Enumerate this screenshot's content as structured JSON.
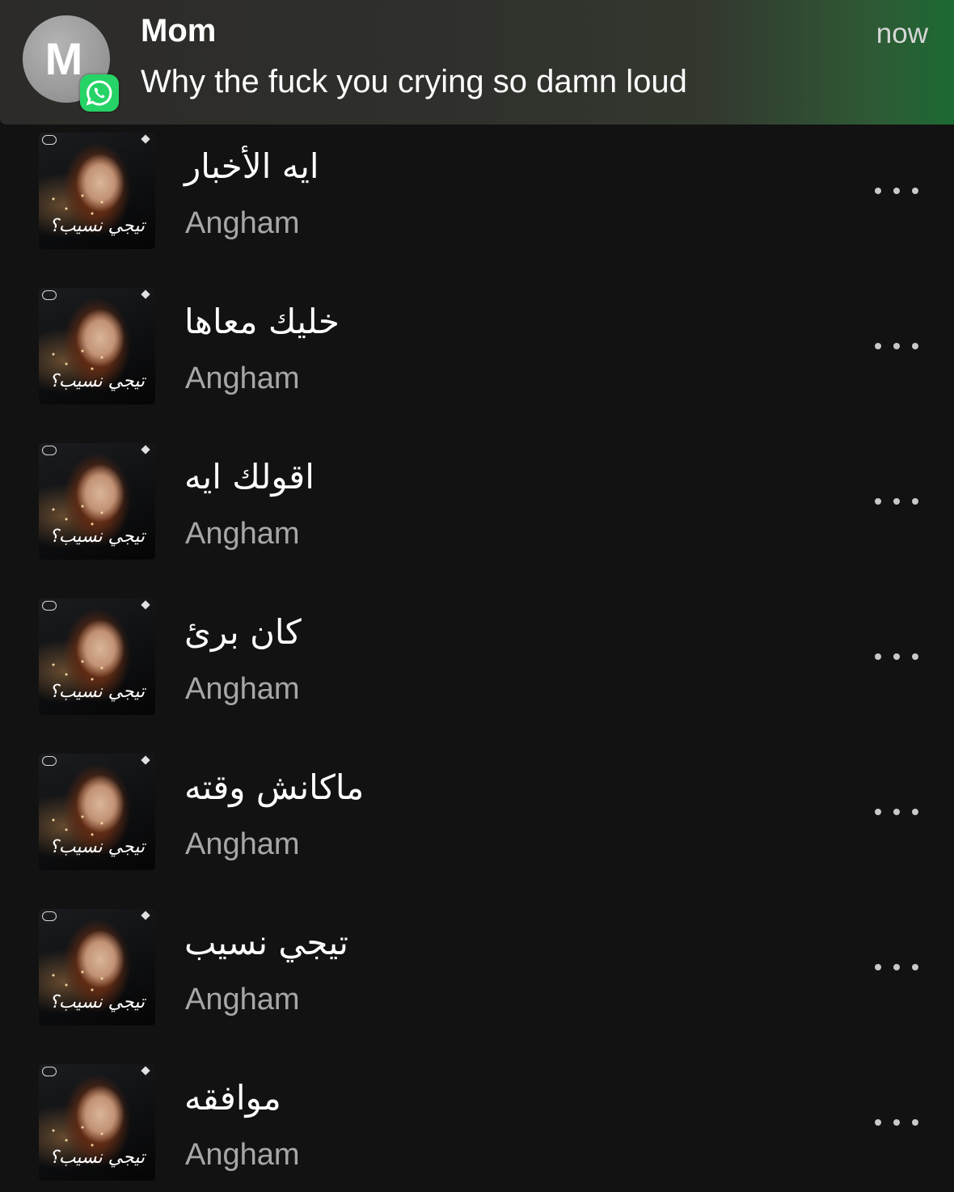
{
  "notification": {
    "avatar_letter": "M",
    "app_icon": "whatsapp-icon",
    "sender": "Mom",
    "message": "Why the fuck you crying so damn loud",
    "time": "now"
  },
  "tracks": [
    {
      "title": "ايه الأخبار",
      "artist": "Angham"
    },
    {
      "title": "خليك معاها",
      "artist": "Angham"
    },
    {
      "title": "اقولك ايه",
      "artist": "Angham"
    },
    {
      "title": "كان برئ",
      "artist": "Angham"
    },
    {
      "title": "ماكانش وقته",
      "artist": "Angham"
    },
    {
      "title": "تيجي نسيب",
      "artist": "Angham"
    },
    {
      "title": "موافقه",
      "artist": "Angham"
    }
  ],
  "cover_art": {
    "text": "تيجي نسيب؟"
  },
  "colors": {
    "background": "#121212",
    "whatsapp_green": "#25d366",
    "artist_gray": "#a7a7a7"
  }
}
